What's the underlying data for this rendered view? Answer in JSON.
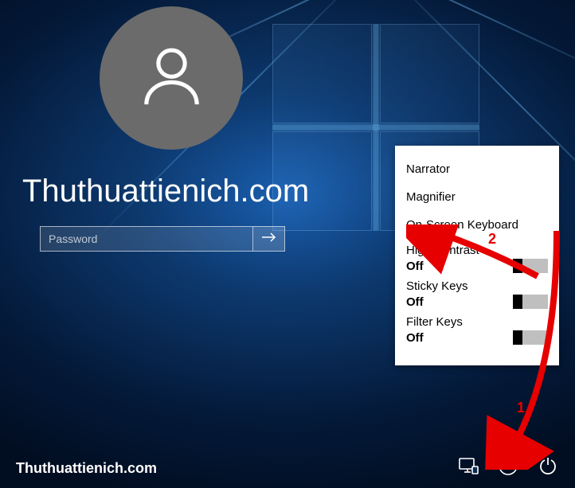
{
  "login": {
    "username": "Thuthuattienich.com",
    "password_placeholder": "Password"
  },
  "ease_of_access": {
    "narrator_label": "Narrator",
    "magnifier_label": "Magnifier",
    "osk_label": "On-Screen Keyboard",
    "high_contrast": {
      "label": "High Contrast",
      "state": "Off"
    },
    "sticky_keys": {
      "label": "Sticky Keys",
      "state": "Off"
    },
    "filter_keys": {
      "label": "Filter Keys",
      "state": "Off"
    }
  },
  "watermark": "Thuthuattienich.com",
  "annotations": {
    "label1": "1",
    "label2": "2"
  }
}
